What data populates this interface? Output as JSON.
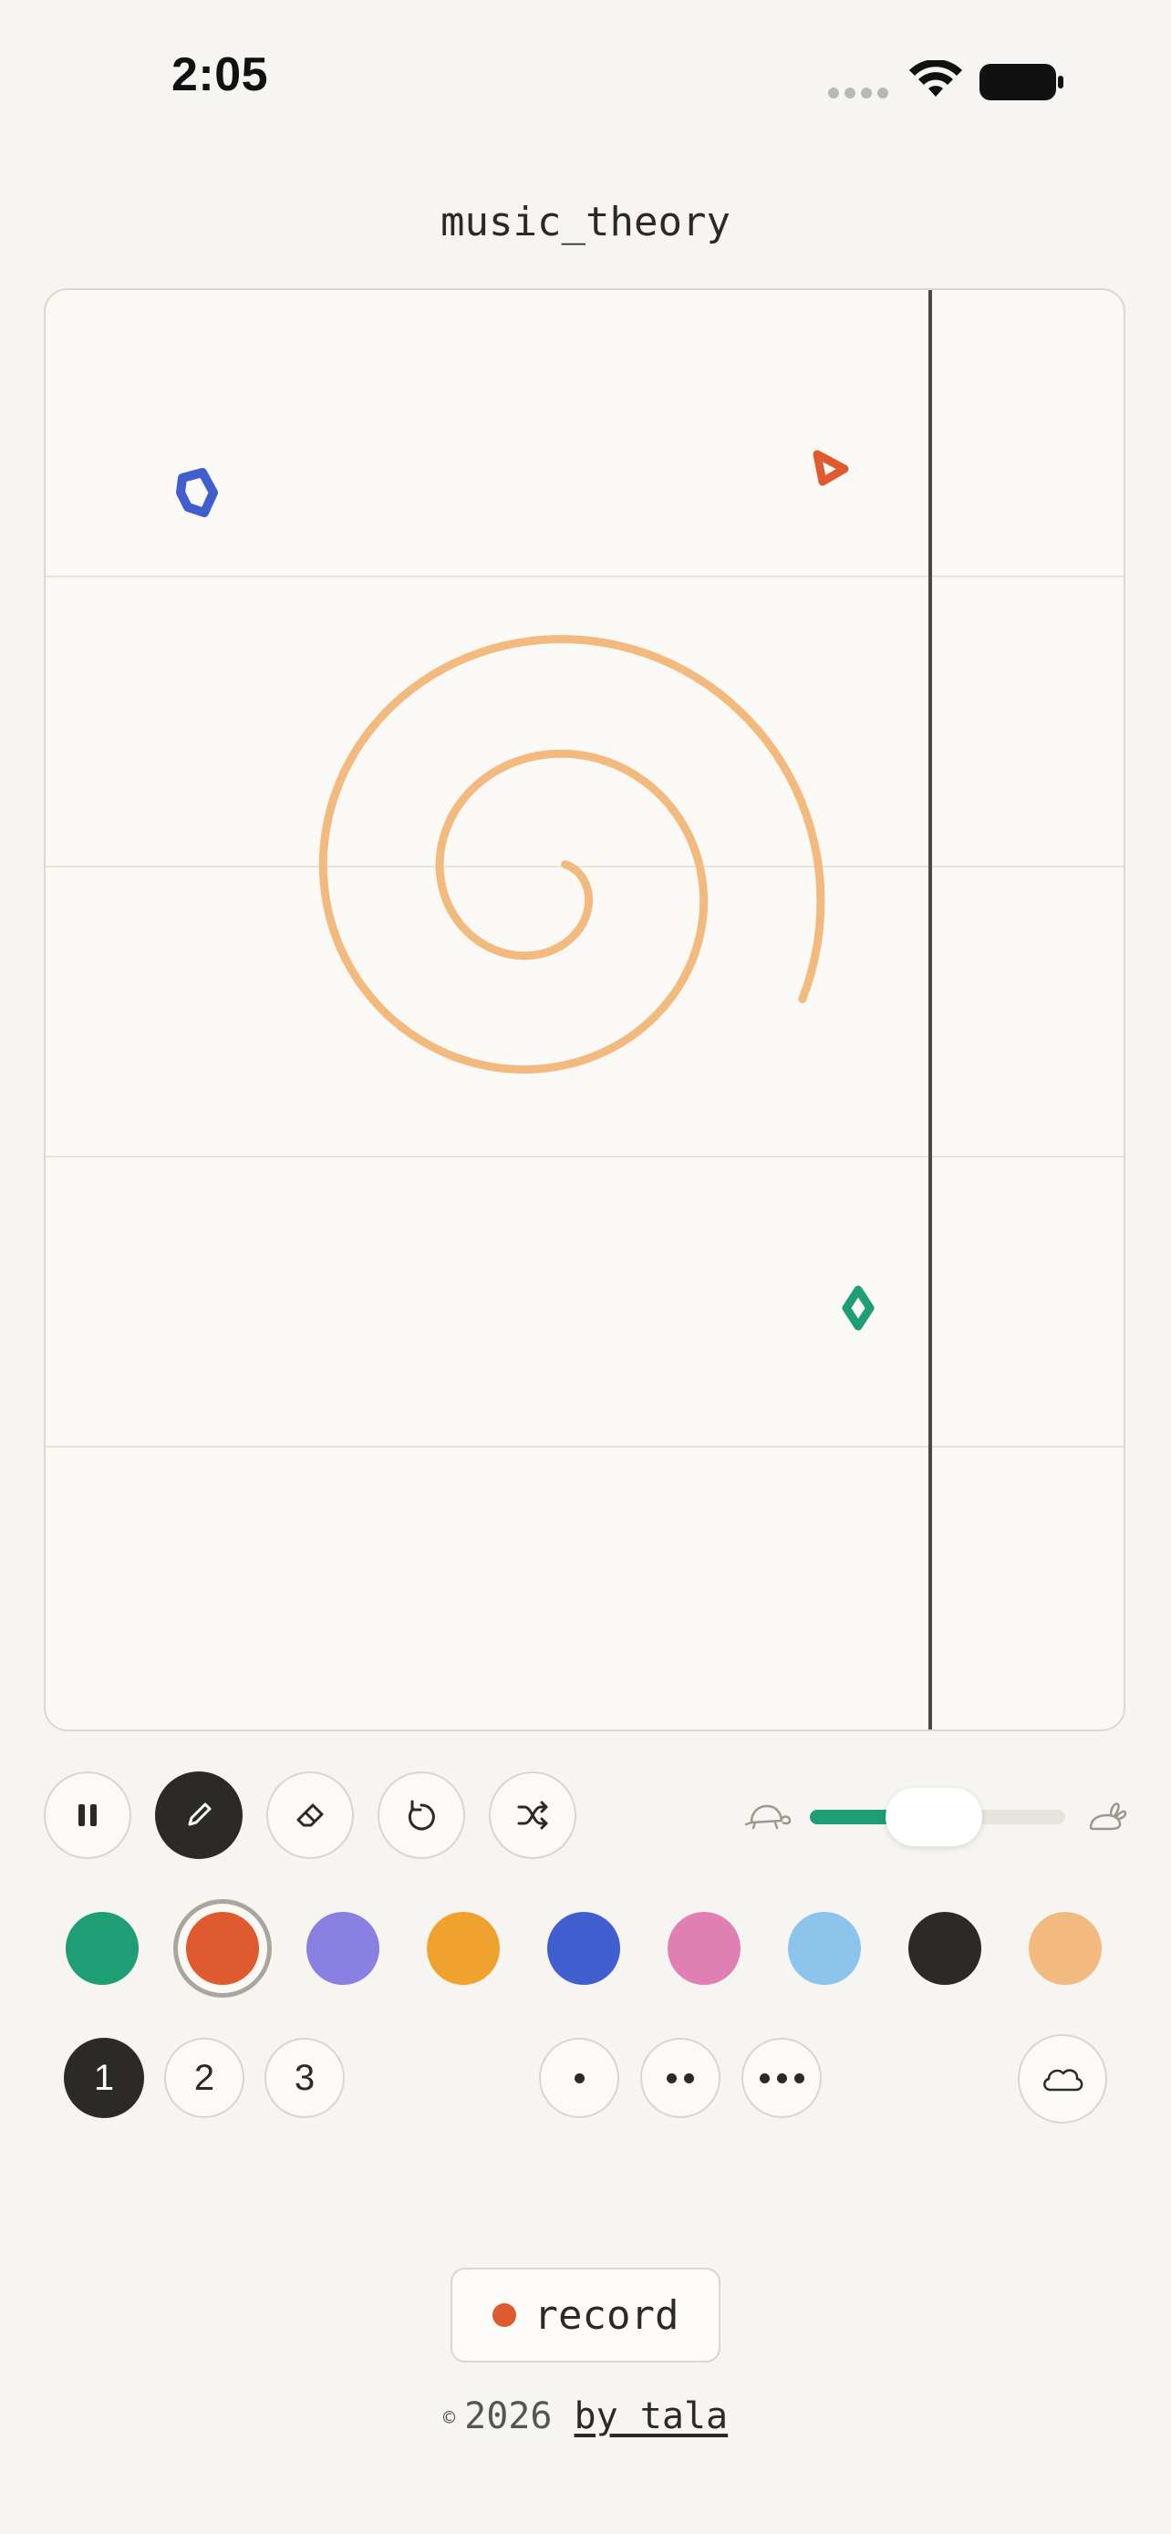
{
  "status_bar": {
    "time": "2:05",
    "icons": [
      "signal-dots-icon",
      "wifi-icon",
      "battery-icon"
    ]
  },
  "title": "music_theory",
  "canvas": {
    "strokes": [
      {
        "shape": "pentagon-blob",
        "color": "#3f5fcf"
      },
      {
        "shape": "triangle",
        "color": "#e05a2f"
      },
      {
        "shape": "spiral",
        "color": "#f2ba7e"
      },
      {
        "shape": "diamond",
        "color": "#1f9e75"
      }
    ],
    "playhead": true
  },
  "toolbar": {
    "pause_icon": "pause-icon",
    "pen_icon": "pen-icon",
    "eraser_icon": "eraser-icon",
    "undo_icon": "undo-icon",
    "shuffle_icon": "shuffle-icon",
    "active_tool": "pen"
  },
  "speed": {
    "value": 0.6,
    "slow_icon": "turtle-icon",
    "fast_icon": "rabbit-icon",
    "fill_color": "#1f9e75"
  },
  "palette": {
    "colors": [
      "#1f9e75",
      "#e05a2f",
      "#8a80e2",
      "#f0a22e",
      "#3f5fcf",
      "#e07fb3",
      "#8cc4ec",
      "#2b2a26",
      "#f2ba7e"
    ],
    "selected_index": 1
  },
  "layers": {
    "options": [
      "1",
      "2",
      "3"
    ],
    "selected": "1"
  },
  "density": {
    "options": [
      1,
      2,
      3
    ]
  },
  "cloud_icon": "cloud-icon",
  "record": {
    "label": "record",
    "dot_color": "#e05a2f"
  },
  "footer": {
    "copyright_symbol": "©",
    "year": "2026",
    "author": "by_tala"
  }
}
